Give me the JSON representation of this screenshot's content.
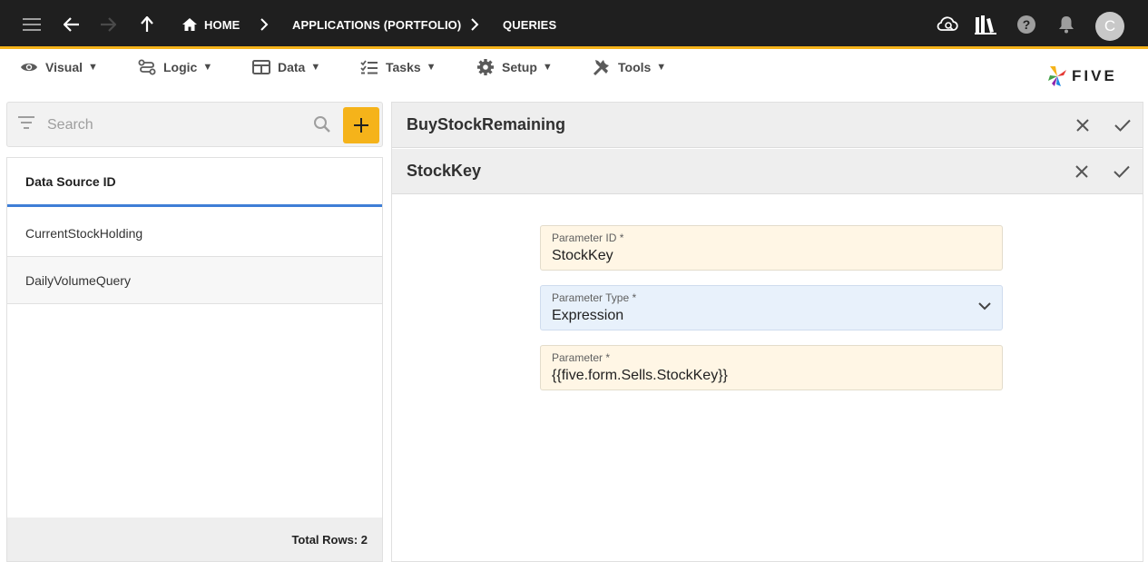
{
  "topbar": {
    "breadcrumbs": [
      "HOME",
      "APPLICATIONS (PORTFOLIO)",
      "QUERIES"
    ],
    "avatar_letter": "C"
  },
  "menu": {
    "items": [
      {
        "label": "Visual",
        "icon": "eye-icon"
      },
      {
        "label": "Logic",
        "icon": "logic-icon"
      },
      {
        "label": "Data",
        "icon": "table-icon"
      },
      {
        "label": "Tasks",
        "icon": "tasks-icon"
      },
      {
        "label": "Setup",
        "icon": "gear-icon"
      },
      {
        "label": "Tools",
        "icon": "tools-icon"
      }
    ],
    "caret": "▼",
    "logo_text": "FIVE"
  },
  "sidebar": {
    "search_placeholder": "Search",
    "column_header": "Data Source ID",
    "rows": [
      "CurrentStockHolding",
      "DailyVolumeQuery"
    ],
    "total_rows": "Total Rows: 2"
  },
  "main": {
    "parent_title": "BuyStockRemaining",
    "form_title": "StockKey",
    "fields": {
      "parameter_id": {
        "label": "Parameter ID *",
        "value": "StockKey"
      },
      "parameter_type": {
        "label": "Parameter Type *",
        "value": "Expression"
      },
      "parameter": {
        "label": "Parameter *",
        "value": "{{five.form.Sells.StockKey}}"
      }
    }
  },
  "colors": {
    "topbar": "#1f1f1f",
    "accent": "#f5b31a",
    "header_underline": "#3e7ed6",
    "required_field": "#fff6e5",
    "select_field": "#e8f1fb"
  }
}
